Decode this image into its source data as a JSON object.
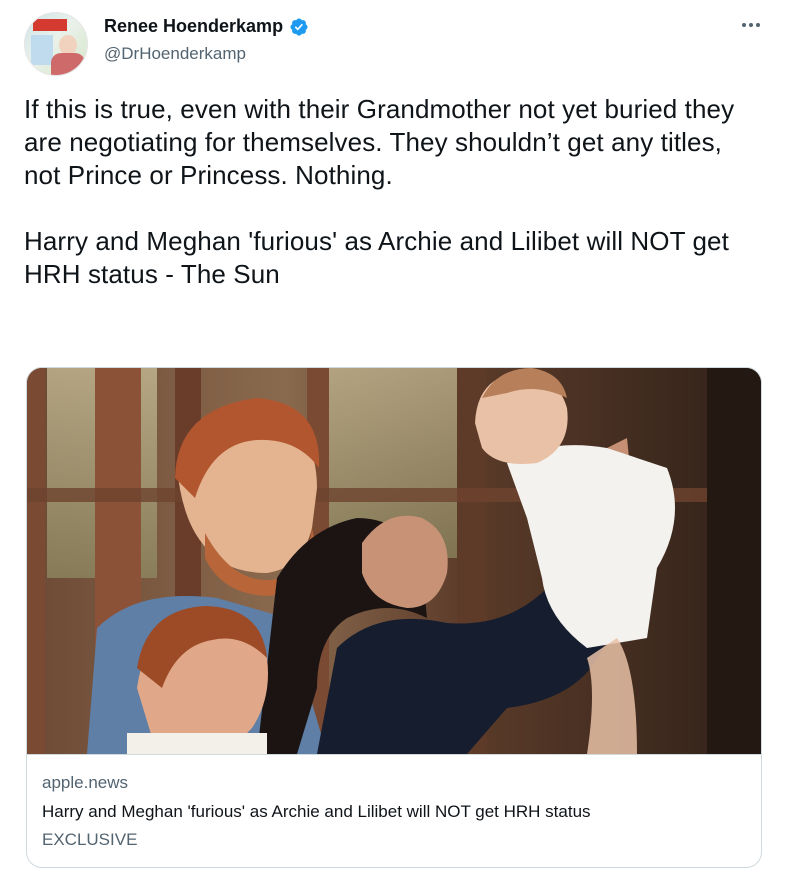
{
  "author": {
    "display_name": "Renee Hoenderkamp",
    "handle": "@DrHoenderkamp",
    "avatar_icon": "profile-photo",
    "verified_icon": "verified-badge-icon",
    "verified_color": "#1d9bf0"
  },
  "tweet": {
    "paragraphs": [
      "If this is true, even with their Grandmother not yet buried they are negotiating for themselves. They shouldn’t get any titles, not Prince or Princess. Nothing.",
      "Harry and Meghan 'furious' as Archie and Lilibet will NOT get HRH status - The Sun"
    ]
  },
  "card": {
    "image_icon": "family-photo",
    "domain": "apple.news",
    "title": "Harry and Meghan 'furious' as Archie and Lilibet will NOT get HRH status",
    "description": "EXCLUSIVE"
  },
  "menu": {
    "more_icon": "more-options-icon"
  },
  "colors": {
    "text": "#0f1419",
    "secondary_text": "#536471",
    "border": "#cfd9de",
    "accent": "#1d9bf0"
  }
}
